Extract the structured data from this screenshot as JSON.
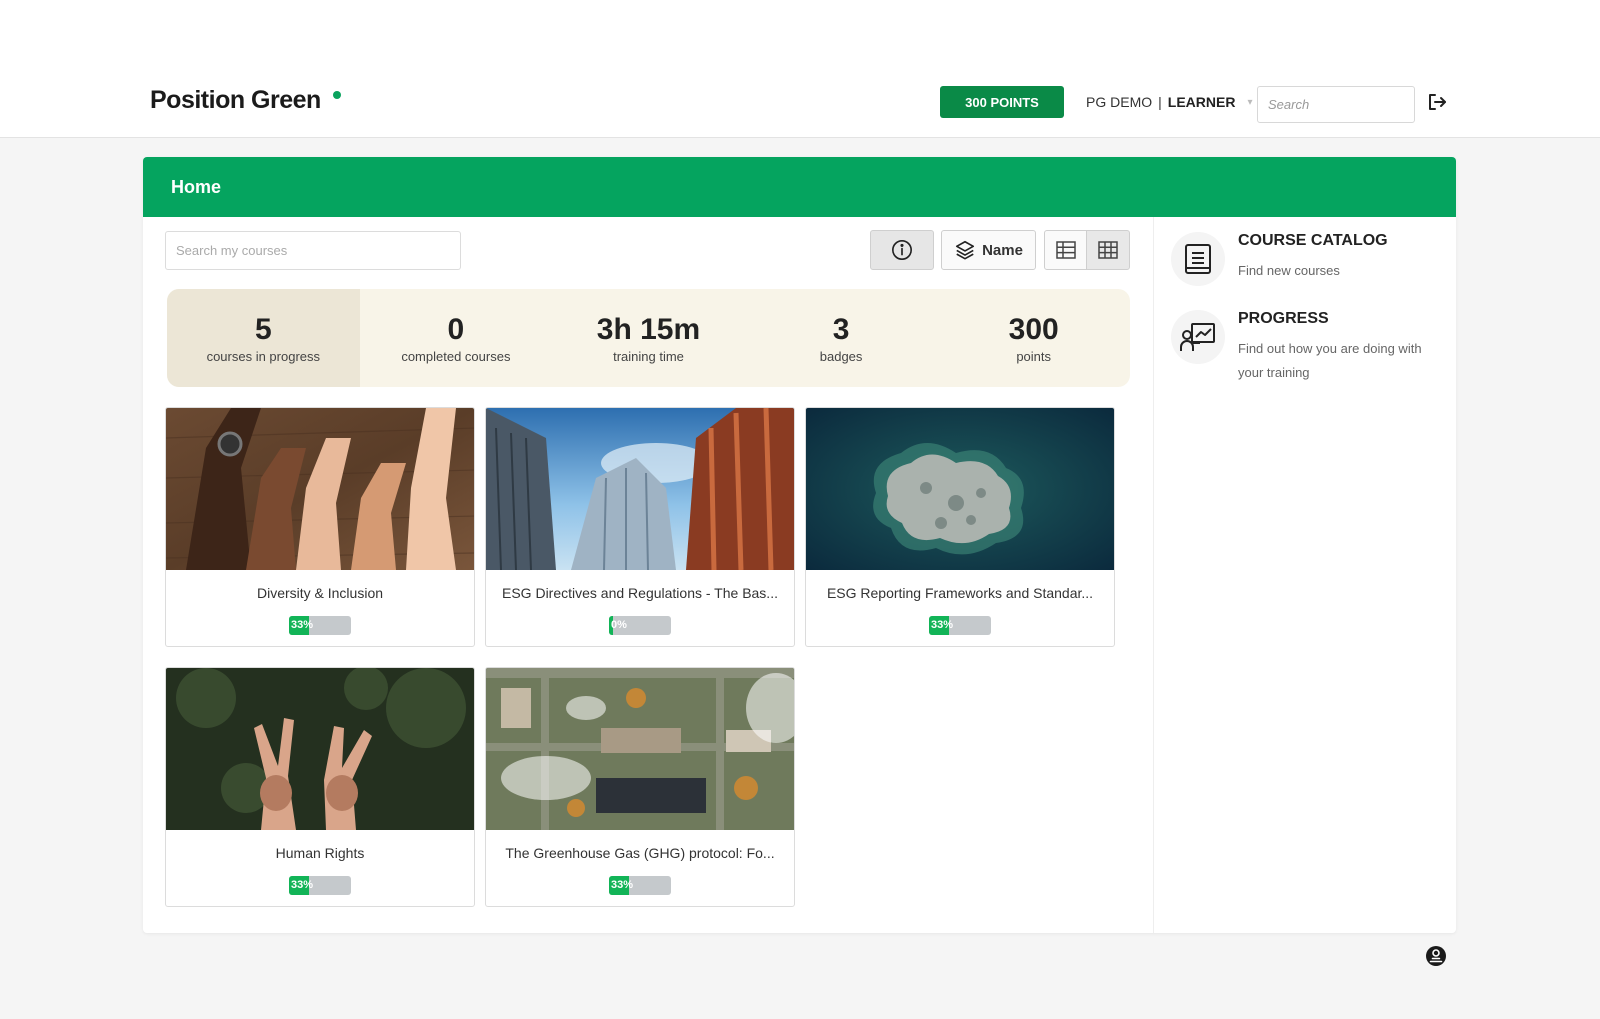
{
  "header": {
    "logo": "Position Green",
    "points_button": "300 POINTS",
    "org": "PG DEMO",
    "separator": "|",
    "role": "LEARNER",
    "search_placeholder": "Search"
  },
  "main": {
    "title": "Home",
    "courses_search_placeholder": "Search my courses",
    "sort_label": "Name",
    "stats": [
      {
        "value": "5",
        "label": "courses in progress"
      },
      {
        "value": "0",
        "label": "completed courses"
      },
      {
        "value": "3h 15m",
        "label": "training time"
      },
      {
        "value": "3",
        "label": "badges"
      },
      {
        "value": "300",
        "label": "points"
      }
    ],
    "courses": [
      {
        "title": "Diversity & Inclusion",
        "progress_label": "33%",
        "progress": 33
      },
      {
        "title": "ESG Directives and Regulations - The Bas...",
        "progress_label": "0%",
        "progress": 0
      },
      {
        "title": "ESG Reporting Frameworks and Standar...",
        "progress_label": "33%",
        "progress": 33
      },
      {
        "title": "Human Rights",
        "progress_label": "33%",
        "progress": 33
      },
      {
        "title": "The Greenhouse Gas (GHG) protocol: Fo...",
        "progress_label": "33%",
        "progress": 33
      }
    ]
  },
  "sidebar": {
    "links": [
      {
        "title": "COURSE CATALOG",
        "desc": "Find new courses"
      },
      {
        "title": "PROGRESS",
        "desc": "Find out how you are doing with your training"
      }
    ]
  },
  "colors": {
    "brand_green": "#05a45f",
    "points_green": "#0a8a47",
    "progress_green": "#12b457",
    "stats_bg": "#f8f4e8"
  },
  "icons": [
    "logout-icon",
    "info-icon",
    "layers-icon",
    "list-view-icon",
    "grid-view-icon",
    "book-icon",
    "progress-chart-icon",
    "help-icon"
  ]
}
